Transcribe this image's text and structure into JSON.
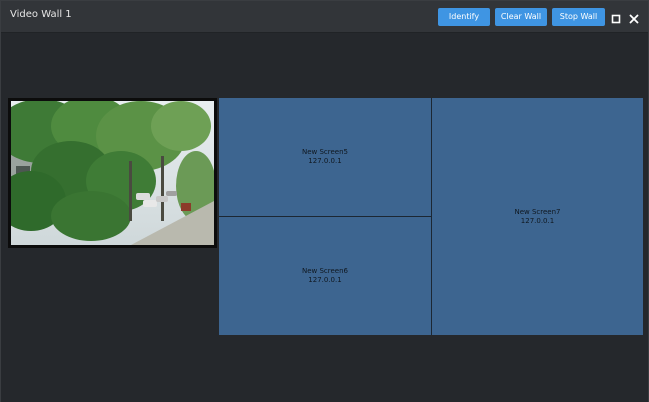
{
  "window": {
    "title": "Video Wall 1"
  },
  "toolbar": {
    "identify_label": "Identify",
    "clear_label": "Clear Wall",
    "stop_label": "Stop Wall",
    "maximize_icon": "maximize-icon",
    "close_icon": "close-icon"
  },
  "colors": {
    "accent": "#3f95e3",
    "screen_tile": "#3d6590",
    "background": "#25282c",
    "titlebar": "#323539"
  },
  "wall": {
    "video_tile": {
      "content": "camera feed (trees and parked cars)"
    },
    "screens": [
      {
        "name": "New Screen5",
        "ip": "127.0.0.1"
      },
      {
        "name": "New Screen6",
        "ip": "127.0.0.1"
      },
      {
        "name": "New Screen7",
        "ip": "127.0.0.1"
      }
    ]
  }
}
